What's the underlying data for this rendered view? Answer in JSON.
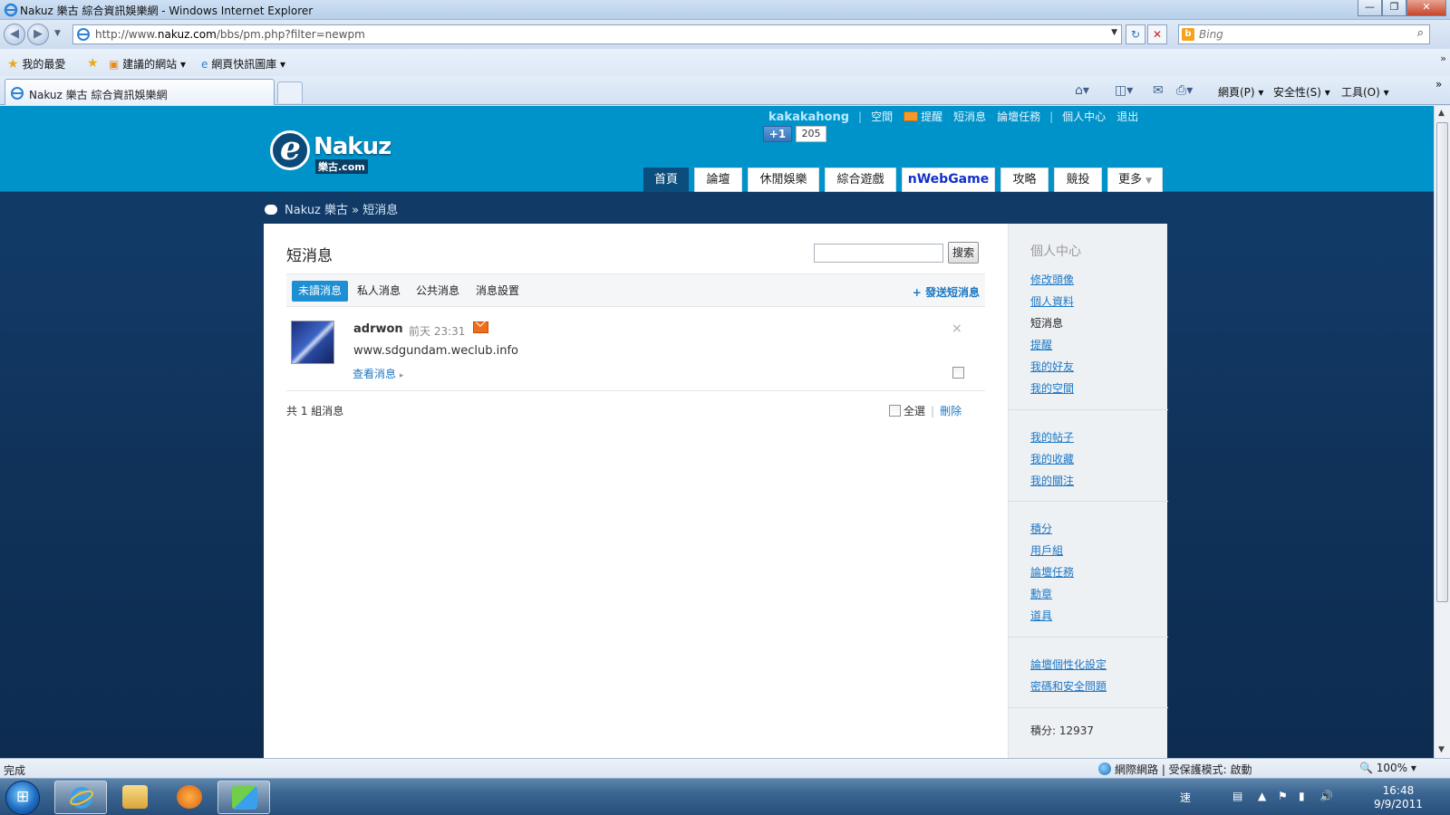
{
  "window": {
    "title": "Nakuz 樂古 綜合資訊娛樂網 - Windows Internet Explorer",
    "minimize": "—",
    "maximize": "❐",
    "close": "✕"
  },
  "address": {
    "url_prefix": "http://www.",
    "url_domain": "nakuz.com",
    "url_path": "/bbs/pm.php?filter=newpm",
    "search_placeholder": "Bing"
  },
  "favorites": {
    "label": "我的最愛",
    "items": [
      "建議的網站",
      "網頁快訊圖庫"
    ]
  },
  "tab": {
    "label": "Nakuz 樂古 綜合資訊娛樂網"
  },
  "commandbar": {
    "page": "網頁(P)",
    "safety": "安全性(S)",
    "tools": "工具(O)"
  },
  "site": {
    "logo_text": "Nakuz",
    "logo_sub": "樂古.com",
    "username": "kakakahong",
    "top_links": [
      "空間",
      "提醒",
      "短消息",
      "論壇任務",
      "個人中心",
      "退出"
    ],
    "plusone": "+1",
    "plusone_count": "205",
    "nav": [
      "首頁",
      "論壇",
      "休閒娛樂",
      "綜合遊戲",
      "nWebGame",
      "攻略",
      "競投",
      "更多"
    ],
    "breadcrumb": "Nakuz 樂古 » 短消息"
  },
  "pm": {
    "title": "短消息",
    "search_button": "搜索",
    "tabs": [
      "未讀消息",
      "私人消息",
      "公共消息",
      "消息設置"
    ],
    "send_link": "+ 發送短消息",
    "messages": [
      {
        "sender": "adrwon",
        "time": "前天 23:31",
        "body": "www.sdgundam.weclub.info",
        "view_link": "查看消息",
        "delete": "×"
      }
    ],
    "total": "共 1 組消息",
    "select_all": "全選",
    "delete_link": "刪除"
  },
  "sidebar": {
    "title": "個人中心",
    "group1": [
      "修改頭像",
      "個人資料",
      "短消息",
      "提醒",
      "我的好友",
      "我的空間"
    ],
    "group2": [
      "我的帖子",
      "我的收藏",
      "我的關注"
    ],
    "group3": [
      "積分",
      "用戶組",
      "論壇任務",
      "勳章",
      "道具"
    ],
    "group4": [
      "論壇個性化設定",
      "密碼和安全問題"
    ],
    "credit": "積分: 12937"
  },
  "status": {
    "text": "完成",
    "zone": "網際網路 | 受保護模式: 啟動",
    "zoom": "100%"
  },
  "taskbar": {
    "time": "16:48",
    "date": "9/9/2011",
    "ime": "速"
  }
}
